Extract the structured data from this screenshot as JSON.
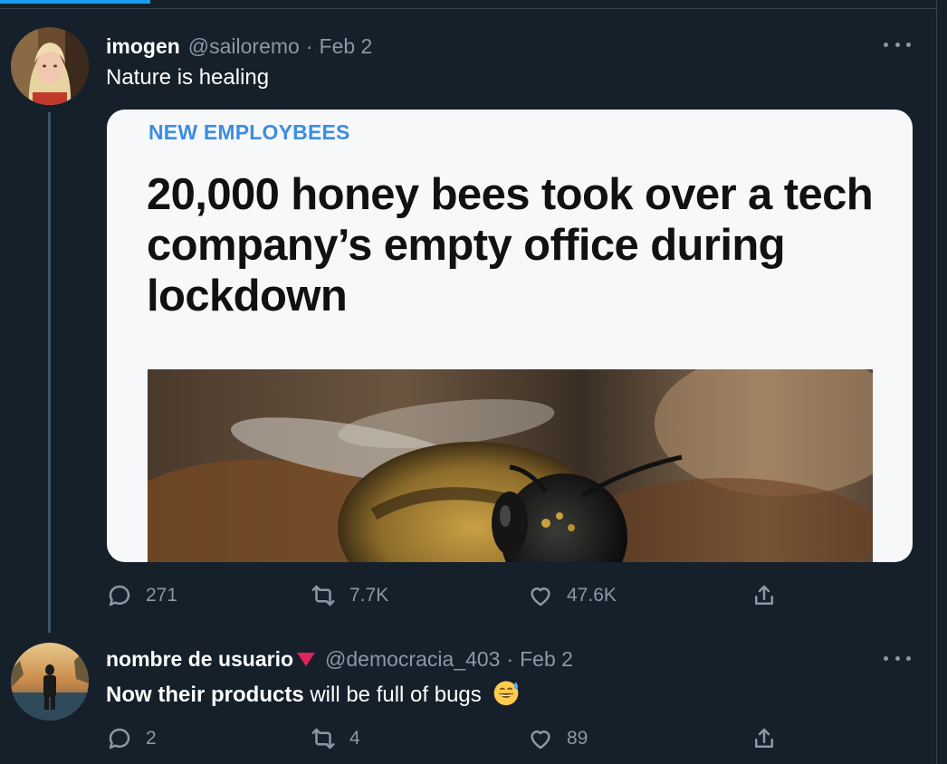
{
  "tweets": [
    {
      "display_name": "imogen",
      "handle": "@sailoremo",
      "separator": "·",
      "date": "Feb 2",
      "text": "Nature is healing",
      "card": {
        "kicker": "NEW EMPLOYBEES",
        "headline": "20,000 honey bees took over a tech company’s empty office during lockdown"
      },
      "actions": {
        "replies": "271",
        "retweets": "7.7K",
        "likes": "47.6K"
      }
    },
    {
      "display_name": "nombre de usuario",
      "handle": "@democracia_403",
      "separator": "·",
      "date": "Feb 2",
      "text_bold": "Now their products",
      "text_rest": " will be full of bugs",
      "emoji": "grinning-face-with-sweat-icon",
      "actions": {
        "replies": "2",
        "retweets": "4",
        "likes": "89"
      }
    }
  ],
  "colors": {
    "background": "#15202b",
    "secondary_text": "#8b98a5",
    "accent": "#1d9bf0",
    "kicker": "#3d8ee0",
    "flag": "#e0245e"
  }
}
